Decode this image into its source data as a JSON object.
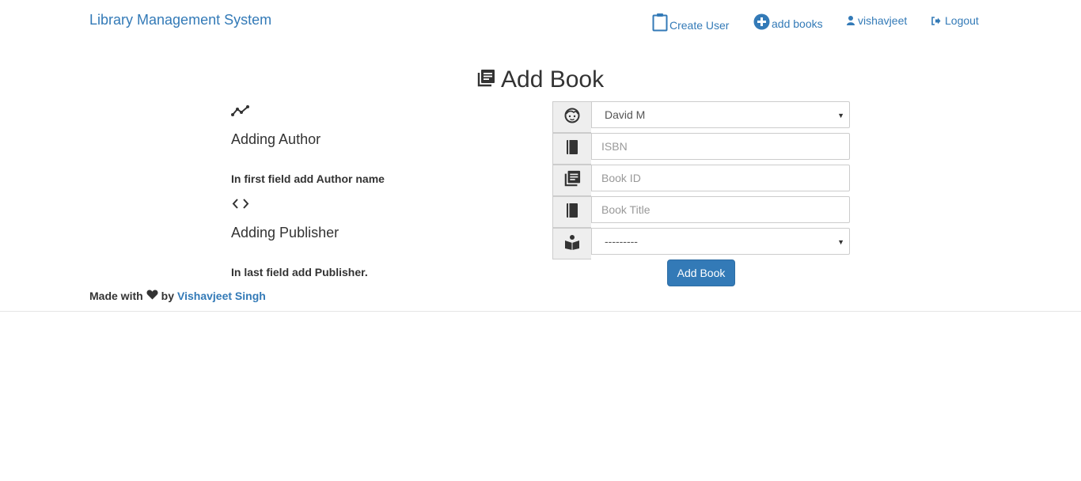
{
  "navbar": {
    "brand": "Library Management System",
    "create_user": "Create User",
    "add_books": "add books",
    "username": "vishavjeet",
    "logout": "Logout"
  },
  "page": {
    "title": "Add Book"
  },
  "help": {
    "author_heading": "Adding Author",
    "author_text": "In first field add Author name",
    "publisher_heading": "Adding Publisher",
    "publisher_text": "In last field add Publisher."
  },
  "form": {
    "author_selected": "David M",
    "isbn_placeholder": "ISBN",
    "book_id_placeholder": "Book ID",
    "book_title_placeholder": "Book Title",
    "publisher_selected": "---------",
    "submit_label": "Add Book"
  },
  "footer": {
    "made_with": "Made with",
    "by": "by",
    "author_link": "Vishavjeet Singh"
  },
  "colors": {
    "link": "#337ab7",
    "primary_button": "#337ab7",
    "addon_bg": "#eeeeee",
    "border": "#cccccc"
  },
  "icons": [
    "clipboard-icon",
    "plus-circle-icon",
    "user-icon",
    "logout-icon",
    "book-list-icon",
    "stats-line-icon",
    "code-icon",
    "face-icon",
    "book-icon",
    "reader-icon",
    "heart-icon"
  ]
}
